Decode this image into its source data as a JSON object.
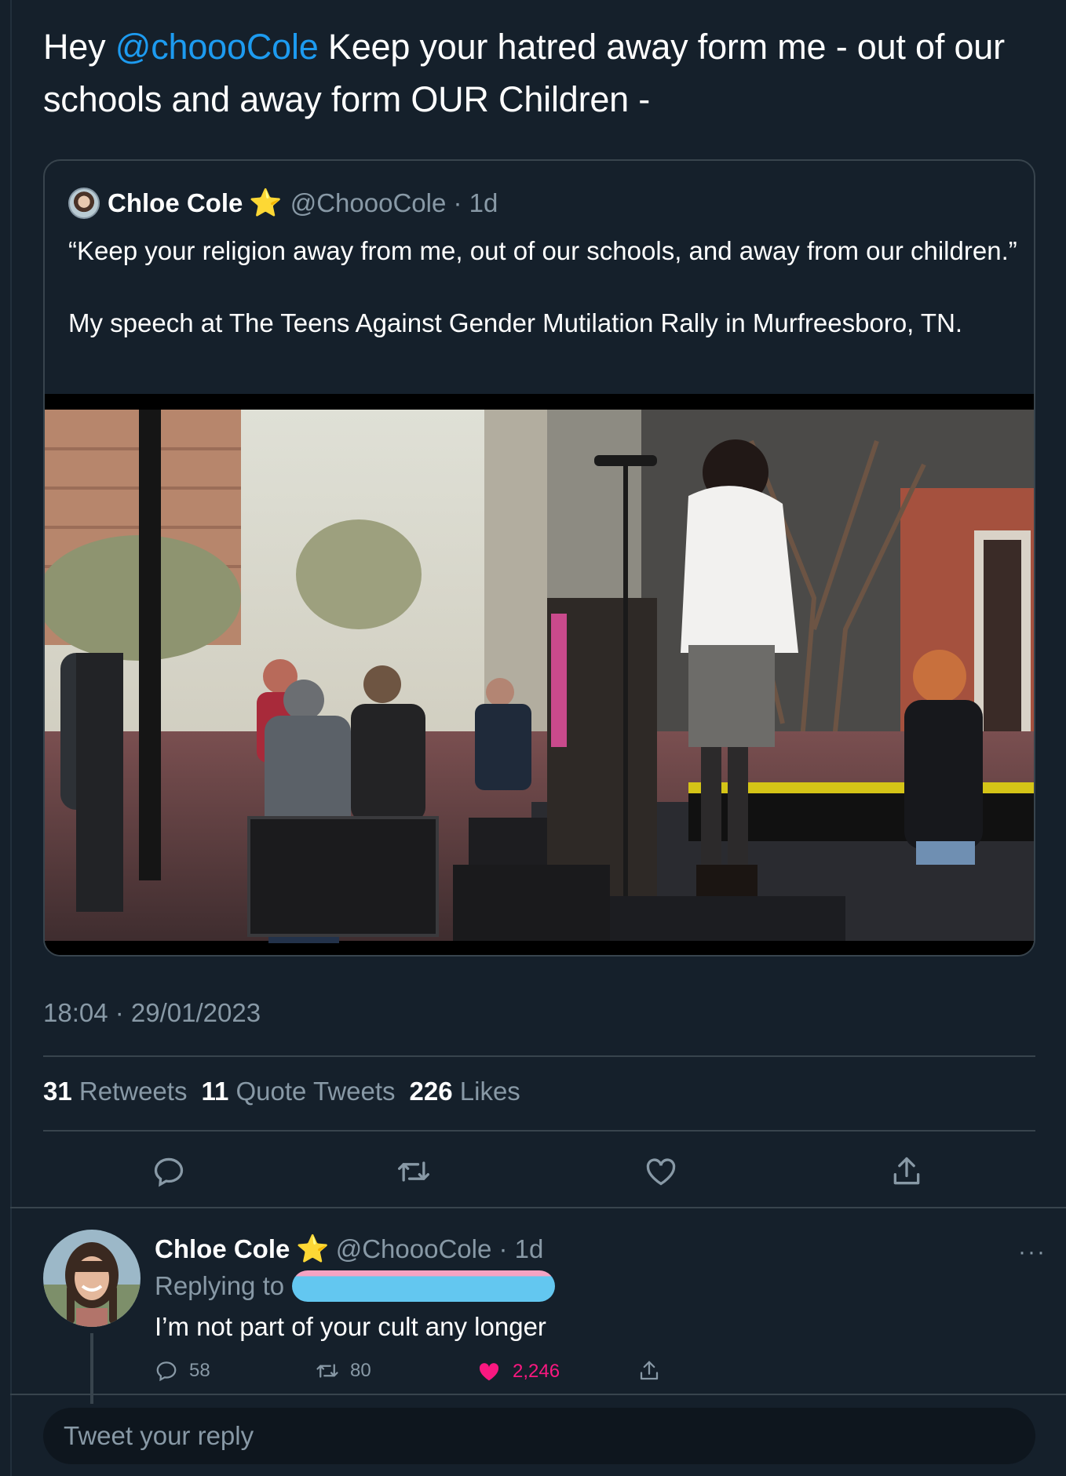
{
  "tweet": {
    "text_prefix": "Hey ",
    "mention": "@choooCole",
    "text_suffix": " Keep your hatred away form me - out of our schools and away form OUR Children -",
    "timestamp": "18:04 · 29/01/2023",
    "stats": {
      "retweets_count": "31",
      "retweets_label": "Retweets",
      "quotes_count": "11",
      "quotes_label": "Quote Tweets",
      "likes_count": "226",
      "likes_label": "Likes"
    }
  },
  "quoted_tweet": {
    "name": "Chloe Cole",
    "badge": "⭐",
    "handle_time": "@ChoooCole · 1d",
    "line1": "“Keep your religion away from me, out of our schools, and away from our children.”",
    "line2": "My speech at The Teens Against Gender Mutilation Rally in Murfreesboro, TN."
  },
  "reply": {
    "name": "Chloe Cole",
    "badge": "⭐",
    "handle_time": "@ChoooCole · 1d",
    "replying_to_label": "Replying to",
    "more": "···",
    "text": "I’m not part of your cult any longer",
    "replies": "58",
    "retweets": "80",
    "likes": "2,246"
  },
  "composer": {
    "placeholder": "Tweet your reply"
  },
  "icons": [
    "reply-icon",
    "retweet-icon",
    "like-icon",
    "share-icon",
    "more-icon"
  ],
  "colors": {
    "background": "#15202b",
    "accent": "#1d9bf0",
    "secondary_text": "#8899a6",
    "like": "#f91880",
    "border": "#38444d"
  }
}
